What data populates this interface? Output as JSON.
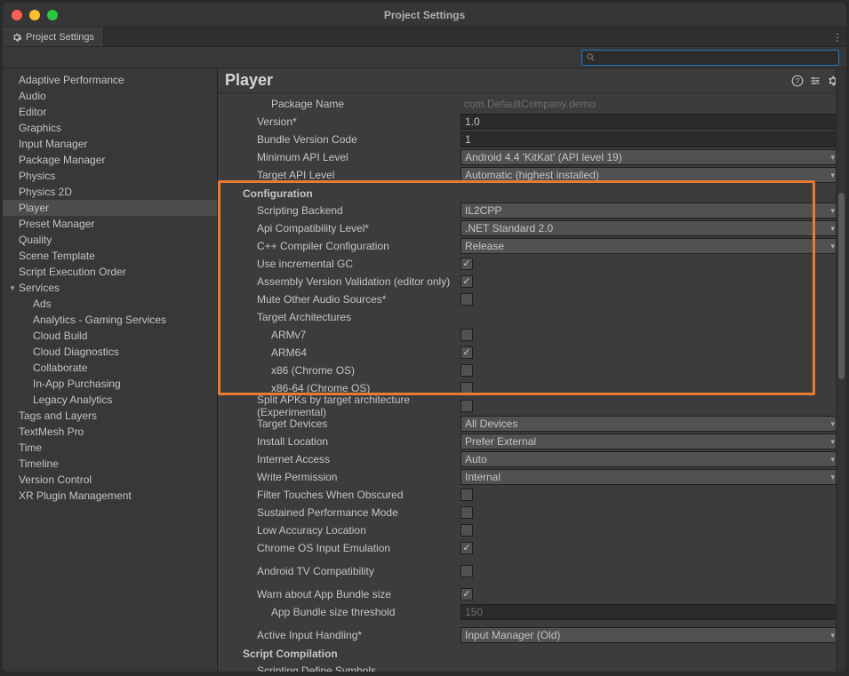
{
  "window": {
    "title": "Project Settings"
  },
  "tab": {
    "label": "Project Settings"
  },
  "sidebar": {
    "items": [
      {
        "label": "Adaptive Performance"
      },
      {
        "label": "Audio"
      },
      {
        "label": "Editor"
      },
      {
        "label": "Graphics"
      },
      {
        "label": "Input Manager"
      },
      {
        "label": "Package Manager"
      },
      {
        "label": "Physics"
      },
      {
        "label": "Physics 2D"
      },
      {
        "label": "Player",
        "selected": true
      },
      {
        "label": "Preset Manager"
      },
      {
        "label": "Quality"
      },
      {
        "label": "Scene Template"
      },
      {
        "label": "Script Execution Order"
      },
      {
        "label": "Services",
        "expandable": true
      },
      {
        "label": "Ads",
        "child": true
      },
      {
        "label": "Analytics - Gaming Services",
        "child": true
      },
      {
        "label": "Cloud Build",
        "child": true
      },
      {
        "label": "Cloud Diagnostics",
        "child": true
      },
      {
        "label": "Collaborate",
        "child": true
      },
      {
        "label": "In-App Purchasing",
        "child": true
      },
      {
        "label": "Legacy Analytics",
        "child": true
      },
      {
        "label": "Tags and Layers"
      },
      {
        "label": "TextMesh Pro"
      },
      {
        "label": "Time"
      },
      {
        "label": "Timeline"
      },
      {
        "label": "Version Control"
      },
      {
        "label": "XR Plugin Management"
      }
    ]
  },
  "main": {
    "title": "Player"
  },
  "fields": {
    "package_name_label": "Package Name",
    "package_name_value": "com.DefaultCompany.demo",
    "version_label": "Version*",
    "version_value": "1.0",
    "bundle_version_code_label": "Bundle Version Code",
    "bundle_version_code_value": "1",
    "min_api_label": "Minimum API Level",
    "min_api_value": "Android 4.4 'KitKat' (API level 19)",
    "target_api_label": "Target API Level",
    "target_api_value": "Automatic (highest installed)",
    "configuration_header": "Configuration",
    "scripting_backend_label": "Scripting Backend",
    "scripting_backend_value": "IL2CPP",
    "api_compat_label": "Api Compatibility Level*",
    "api_compat_value": ".NET Standard 2.0",
    "cpp_compiler_label": "C++ Compiler Configuration",
    "cpp_compiler_value": "Release",
    "incremental_gc_label": "Use incremental GC",
    "assembly_version_label": "Assembly Version Validation (editor only)",
    "mute_audio_label": "Mute Other Audio Sources*",
    "target_arch_label": "Target Architectures",
    "armv7_label": "ARMv7",
    "arm64_label": "ARM64",
    "x86_label": "x86 (Chrome OS)",
    "x86_64_label": "x86-64 (Chrome OS)",
    "split_apk_label": "Split APKs by target architecture (Experimental)",
    "target_devices_label": "Target Devices",
    "target_devices_value": "All Devices",
    "install_location_label": "Install Location",
    "install_location_value": "Prefer External",
    "internet_access_label": "Internet Access",
    "internet_access_value": "Auto",
    "write_permission_label": "Write Permission",
    "write_permission_value": "Internal",
    "filter_touches_label": "Filter Touches When Obscured",
    "sustained_perf_label": "Sustained Performance Mode",
    "low_accuracy_label": "Low Accuracy Location",
    "chrome_emulation_label": "Chrome OS Input Emulation",
    "android_tv_label": "Android TV Compatibility",
    "warn_bundle_label": "Warn about App Bundle size",
    "bundle_threshold_label": "App Bundle size threshold",
    "bundle_threshold_value": "150",
    "active_input_label": "Active Input Handling*",
    "active_input_value": "Input Manager (Old)",
    "script_compilation_header": "Script Compilation",
    "scripting_define_label": "Scripting Define Symbols"
  }
}
